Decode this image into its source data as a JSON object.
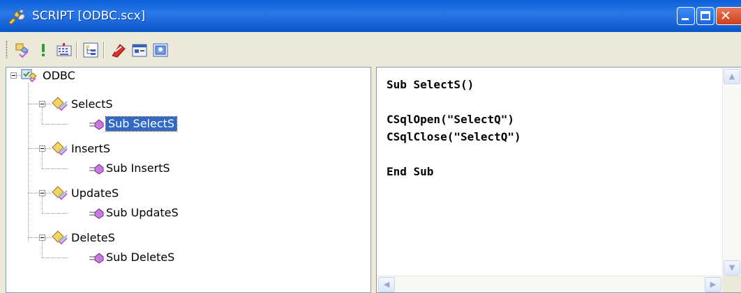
{
  "window": {
    "title": "SCRIPT [ODBC.scx]",
    "colors": {
      "titlebar": "#0a5fd8",
      "selection": "#316ac5",
      "close": "#cf3e1b"
    }
  },
  "toolbar": {
    "buttons": [
      {
        "icon": "add-procedure-icon"
      },
      {
        "icon": "run-exclamation-icon"
      },
      {
        "icon": "keyboard-icon"
      },
      {
        "icon": "tree-view-icon"
      },
      {
        "icon": "fast-sql-icon"
      },
      {
        "icon": "dialog-form-icon"
      },
      {
        "icon": "screen-window-icon"
      }
    ]
  },
  "tree": {
    "root": "ODBC",
    "groups": [
      {
        "name": "SelectS",
        "child": "Sub SelectS",
        "selected": true
      },
      {
        "name": "InsertS",
        "child": "Sub InsertS",
        "selected": false
      },
      {
        "name": "UpdateS",
        "child": "Sub UpdateS",
        "selected": false
      },
      {
        "name": "DeleteS",
        "child": "Sub DeleteS",
        "selected": false
      }
    ]
  },
  "code": {
    "lines": [
      "Sub SelectS()",
      "",
      "CSqlOpen(\"SelectQ\")",
      "CSqlClose(\"SelectQ\")",
      "",
      "End Sub"
    ]
  },
  "scrollbars": {
    "up": "▲",
    "down": "▼",
    "left": "◀",
    "right": "▶"
  }
}
